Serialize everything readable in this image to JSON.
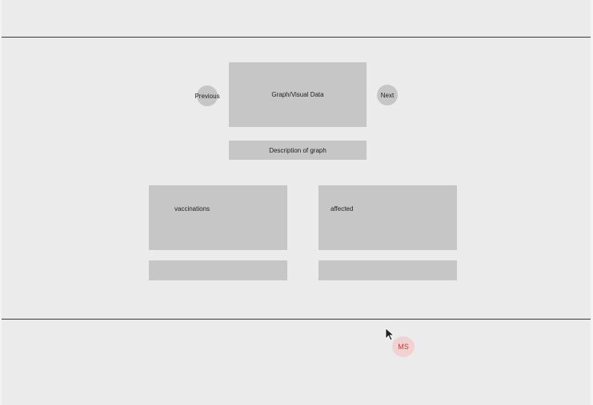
{
  "wireframe": {
    "graph": {
      "label": "Graph/Visual Data",
      "previous_label": "Previous",
      "next_label": "Next",
      "description_label": "Description of graph"
    },
    "cards": [
      {
        "label": "vaccinations"
      },
      {
        "label": "affected"
      }
    ]
  },
  "overlay": {
    "presenter_initials": "MS",
    "cursor_icon": "arrow-cursor-icon"
  },
  "colors": {
    "background": "#ebebeb",
    "placeholder": "#c7c6c6",
    "divider": "#3a3a3a",
    "badge_bg": "#f0d2d2",
    "badge_text": "#c0392b"
  }
}
